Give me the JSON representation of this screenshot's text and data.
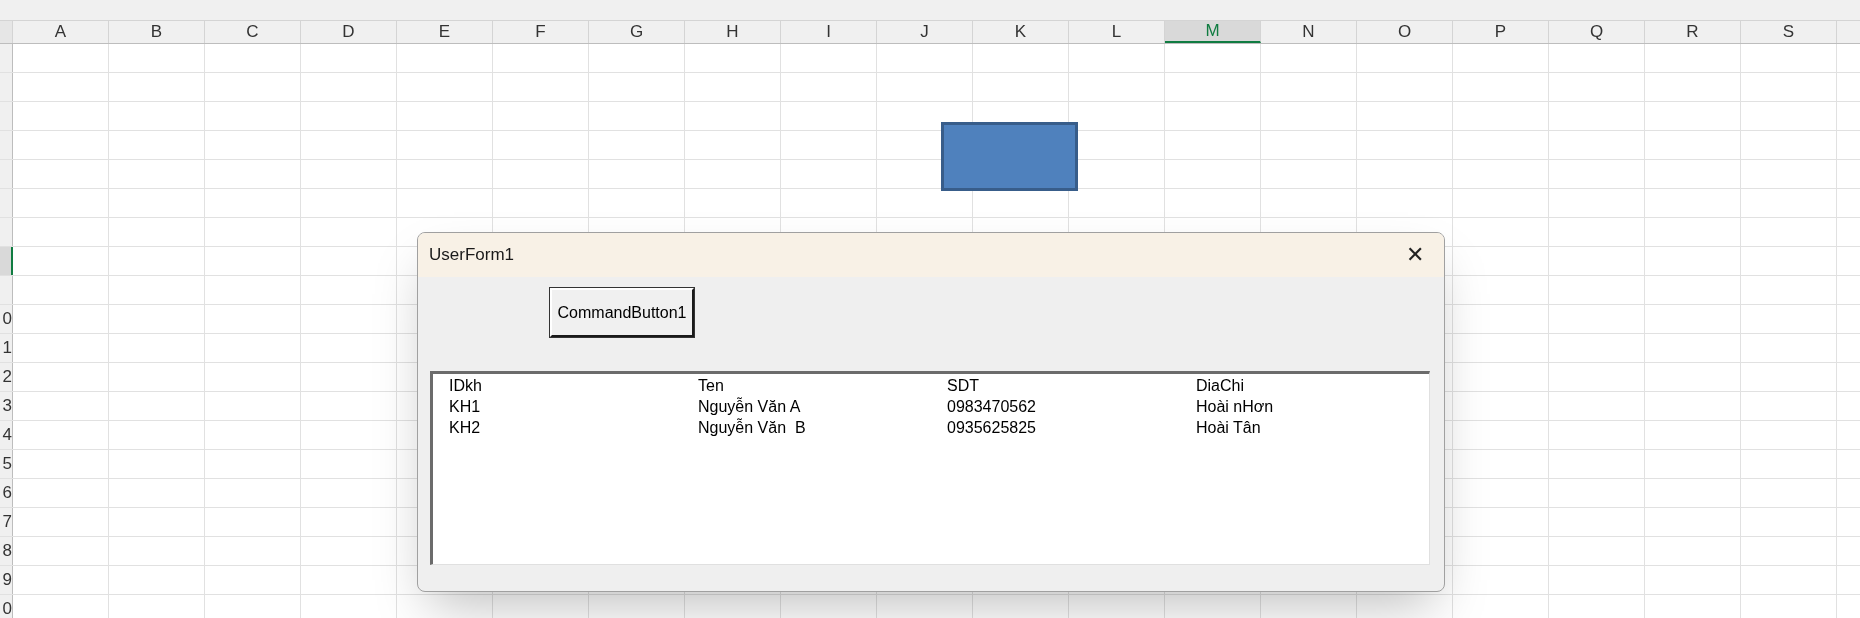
{
  "sheet": {
    "columns": [
      {
        "label": "A",
        "selected": false
      },
      {
        "label": "B",
        "selected": false
      },
      {
        "label": "C",
        "selected": false
      },
      {
        "label": "D",
        "selected": false
      },
      {
        "label": "E",
        "selected": false
      },
      {
        "label": "F",
        "selected": false
      },
      {
        "label": "G",
        "selected": false
      },
      {
        "label": "H",
        "selected": false
      },
      {
        "label": "I",
        "selected": false
      },
      {
        "label": "J",
        "selected": false
      },
      {
        "label": "K",
        "selected": false
      },
      {
        "label": "L",
        "selected": false
      },
      {
        "label": "M",
        "selected": true
      },
      {
        "label": "N",
        "selected": false
      },
      {
        "label": "O",
        "selected": false
      },
      {
        "label": "P",
        "selected": false
      },
      {
        "label": "Q",
        "selected": false
      },
      {
        "label": "R",
        "selected": false
      },
      {
        "label": "S",
        "selected": false
      }
    ],
    "rows": [
      {
        "selected": false
      },
      {
        "selected": false
      },
      {
        "selected": false
      },
      {
        "selected": false
      },
      {
        "selected": false
      },
      {
        "selected": false
      },
      {
        "selected": false
      },
      {
        "selected": true
      },
      {
        "selected": false
      },
      {
        "label": "0",
        "selected": false
      },
      {
        "label": "1",
        "selected": false
      },
      {
        "label": "2",
        "selected": false
      },
      {
        "label": "3",
        "selected": false
      },
      {
        "label": "4",
        "selected": false
      },
      {
        "label": "5",
        "selected": false
      },
      {
        "label": "6",
        "selected": false
      },
      {
        "label": "7",
        "selected": false
      },
      {
        "label": "8",
        "selected": false
      },
      {
        "label": "9",
        "selected": false
      },
      {
        "label": "0",
        "selected": false
      }
    ]
  },
  "dialog": {
    "title": "UserForm1",
    "close": "✕",
    "button": "CommandButton1",
    "list": [
      [
        "IDkh",
        "Ten",
        "SDT",
        "DiaChi"
      ],
      [
        "KH1",
        "Nguyễn Văn A",
        "0983470562",
        "Hoài nHơn"
      ],
      [
        "KH2",
        "Nguyễn Văn  B",
        "0935625825",
        "Hoài Tân"
      ]
    ]
  }
}
